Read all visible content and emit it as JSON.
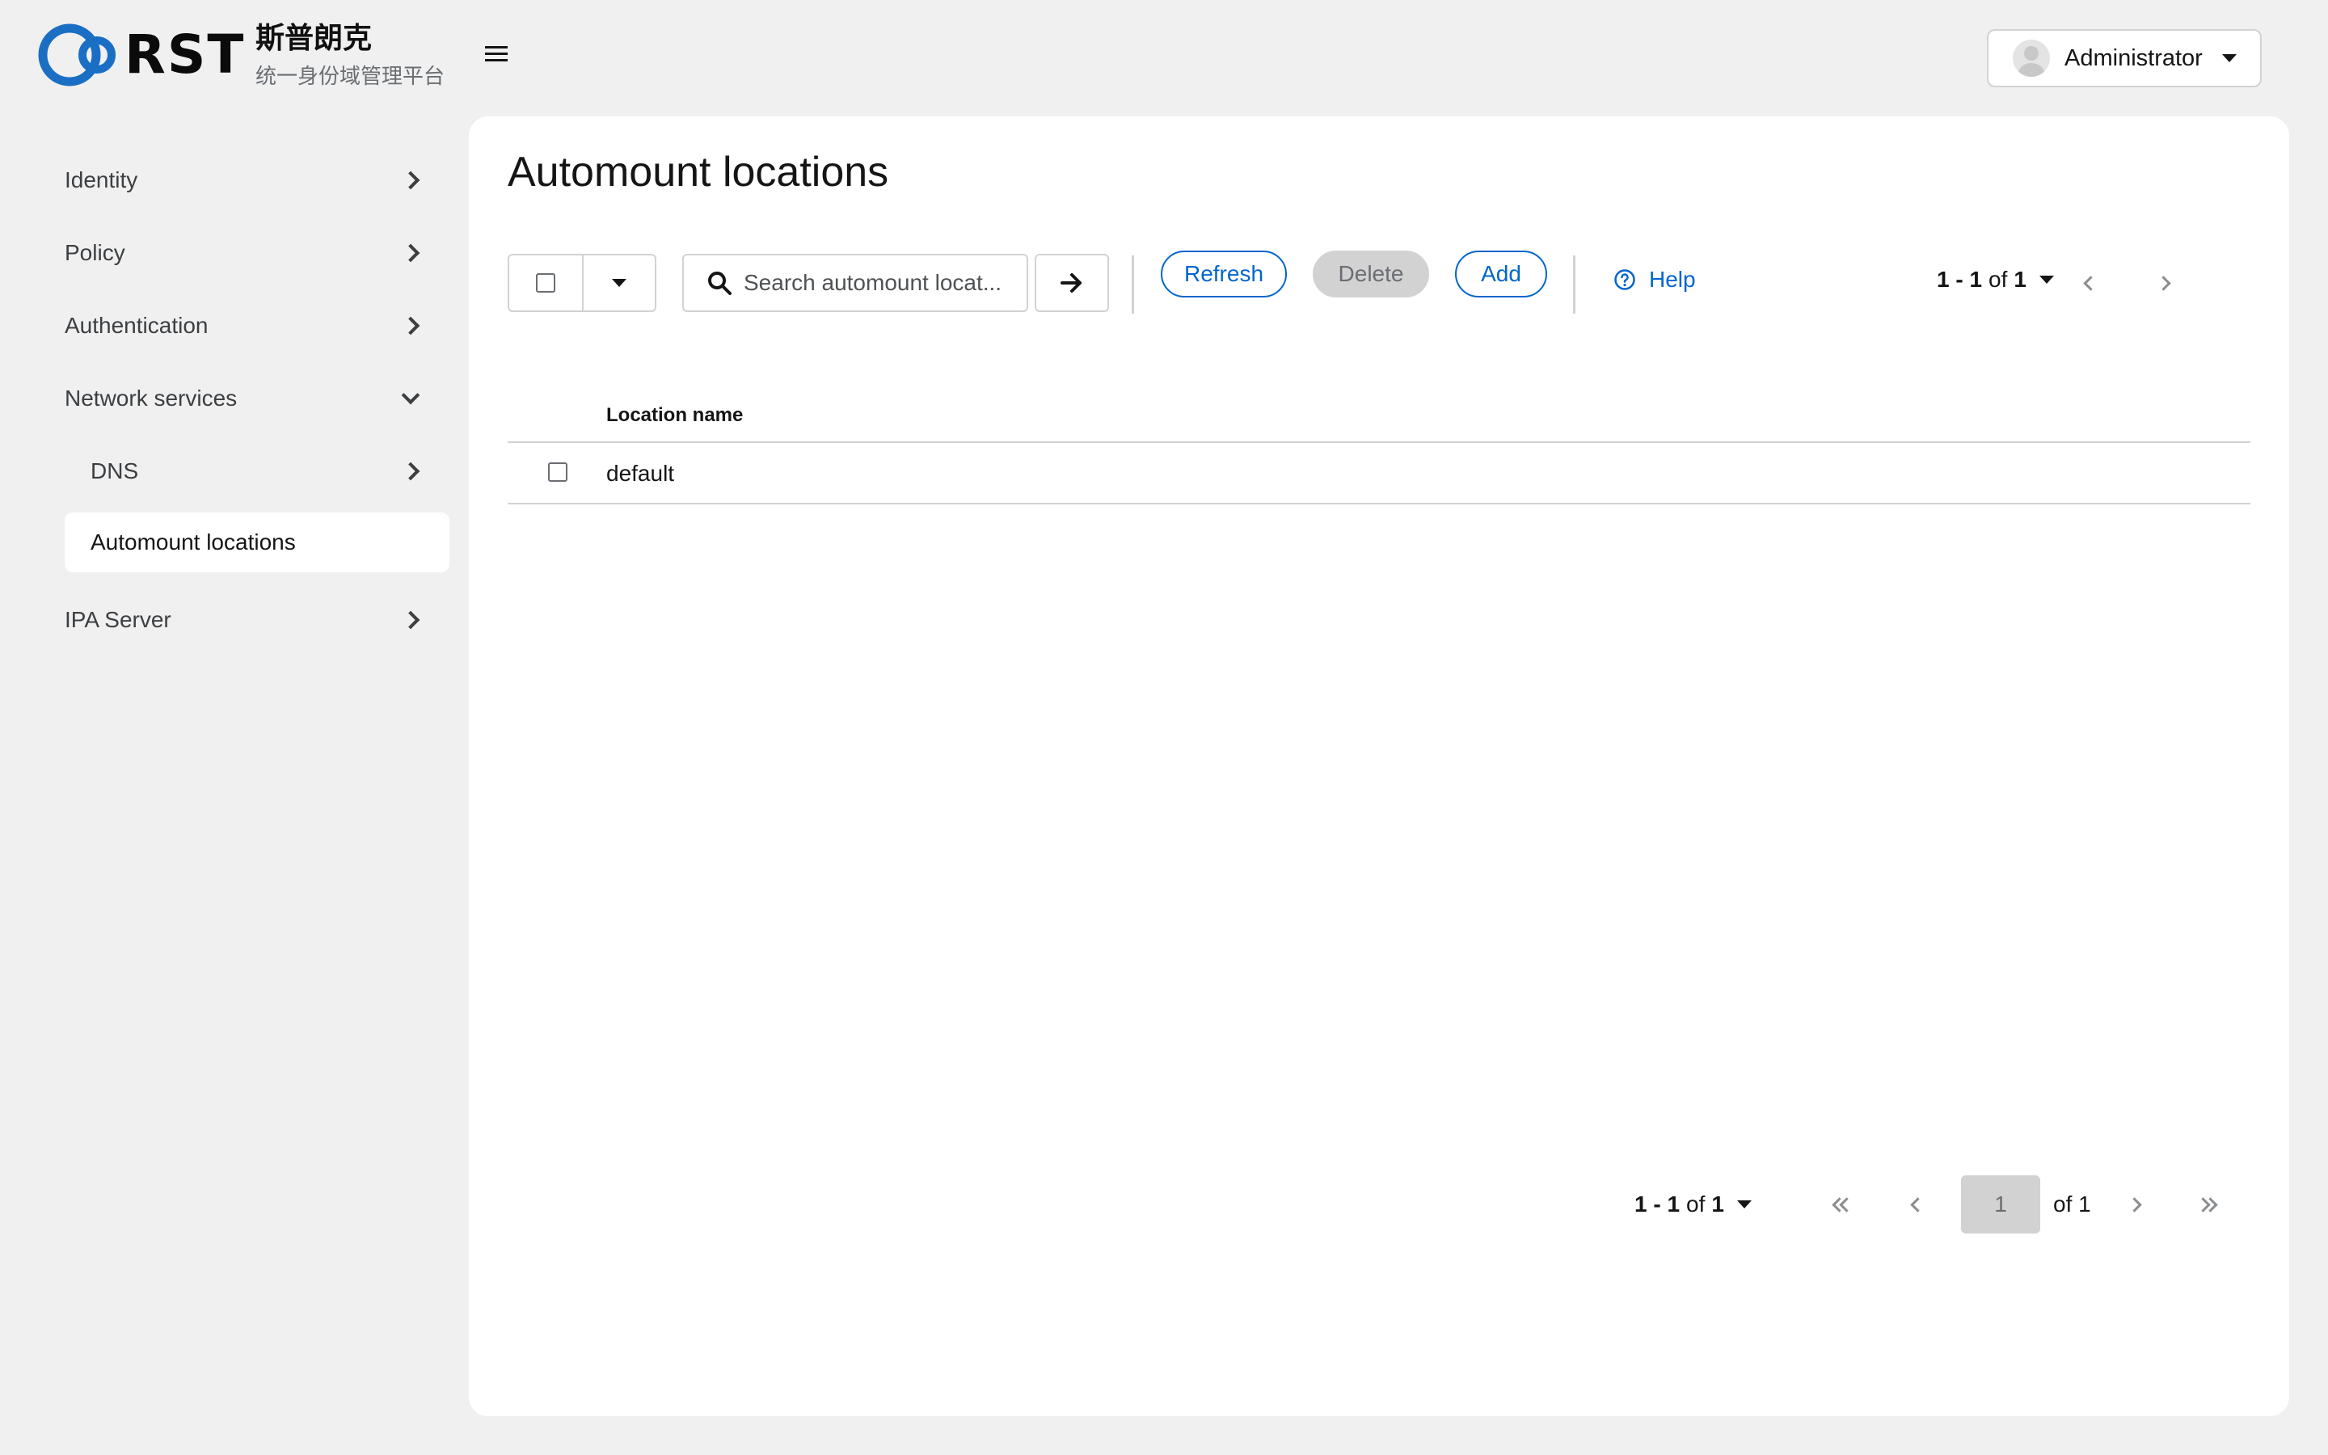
{
  "brand": {
    "name": "RST",
    "cn_title": "斯普朗克",
    "cn_subtitle": "统一身份域管理平台",
    "accent_color": "#0066cc"
  },
  "header": {
    "menu_icon": "hamburger-icon",
    "user": {
      "name": "Administrator",
      "icon": "avatar-icon"
    }
  },
  "sidebar": {
    "items": [
      {
        "label": "Identity",
        "expanded": false
      },
      {
        "label": "Policy",
        "expanded": false
      },
      {
        "label": "Authentication",
        "expanded": false
      },
      {
        "label": "Network services",
        "expanded": true
      },
      {
        "label": "DNS",
        "expanded": false
      },
      {
        "label": "Automount locations",
        "active": true
      },
      {
        "label": "IPA Server",
        "expanded": false
      }
    ]
  },
  "main": {
    "title": "Automount locations",
    "toolbar": {
      "search_placeholder": "Search automount locat...",
      "refresh_label": "Refresh",
      "delete_label": "Delete",
      "add_label": "Add",
      "help_label": "Help"
    },
    "pager_top": {
      "range": "1 - 1",
      "of_word": "of",
      "total": "1"
    },
    "table": {
      "columns": [
        "Location name"
      ],
      "rows": [
        {
          "name": "default",
          "checked": false
        }
      ]
    },
    "pager_bottom": {
      "range": "1 - 1",
      "of_word": "of",
      "total": "1",
      "current_page": "1",
      "of_pages": "of 1"
    }
  }
}
